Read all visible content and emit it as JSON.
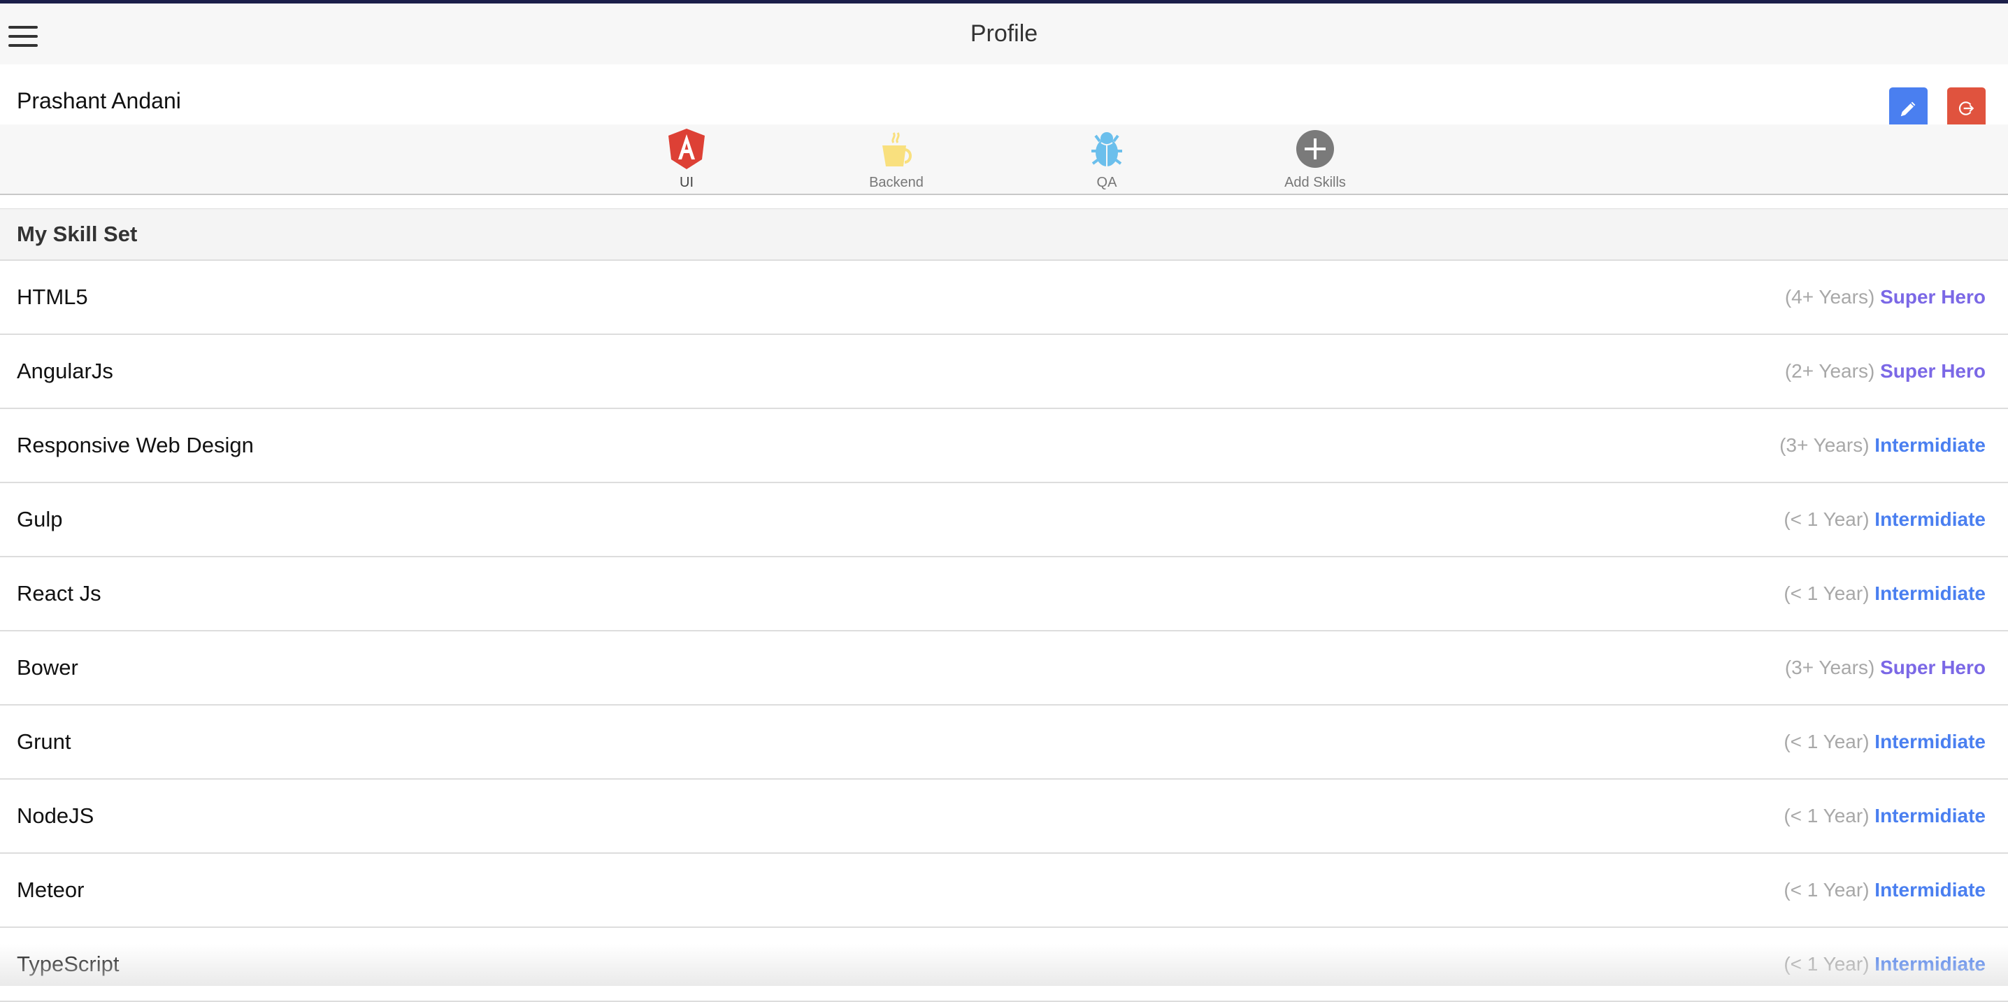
{
  "header": {
    "title": "Profile"
  },
  "profile": {
    "name": "Prashant Andani"
  },
  "tabs": [
    {
      "label": "UI",
      "icon": "angular-icon"
    },
    {
      "label": "Backend",
      "icon": "coffee-cup-icon"
    },
    {
      "label": "QA",
      "icon": "bug-icon"
    },
    {
      "label": "Add Skills",
      "icon": "plus-circle-icon"
    }
  ],
  "skills": {
    "heading": "My Skill Set",
    "items": [
      {
        "name": "HTML5",
        "years": "(4+ Years)",
        "level": "Super Hero"
      },
      {
        "name": "AngularJs",
        "years": "(2+ Years)",
        "level": "Super Hero"
      },
      {
        "name": "Responsive Web Design",
        "years": "(3+ Years)",
        "level": "Intermidiate"
      },
      {
        "name": "Gulp",
        "years": "(< 1 Year)",
        "level": "Intermidiate"
      },
      {
        "name": "React Js",
        "years": "(< 1 Year)",
        "level": "Intermidiate"
      },
      {
        "name": "Bower",
        "years": "(3+ Years)",
        "level": "Super Hero"
      },
      {
        "name": "Grunt",
        "years": "(< 1 Year)",
        "level": "Intermidiate"
      },
      {
        "name": "NodeJS",
        "years": "(< 1 Year)",
        "level": "Intermidiate"
      },
      {
        "name": "Meteor",
        "years": "(< 1 Year)",
        "level": "Intermidiate"
      },
      {
        "name": "TypeScript",
        "years": "(< 1 Year)",
        "level": "Intermidiate"
      }
    ]
  },
  "colors": {
    "super_hero": "#7b68e6",
    "intermidiate": "#4a7ff0",
    "edit": "#4a7ff0",
    "logout": "#e0533e"
  }
}
